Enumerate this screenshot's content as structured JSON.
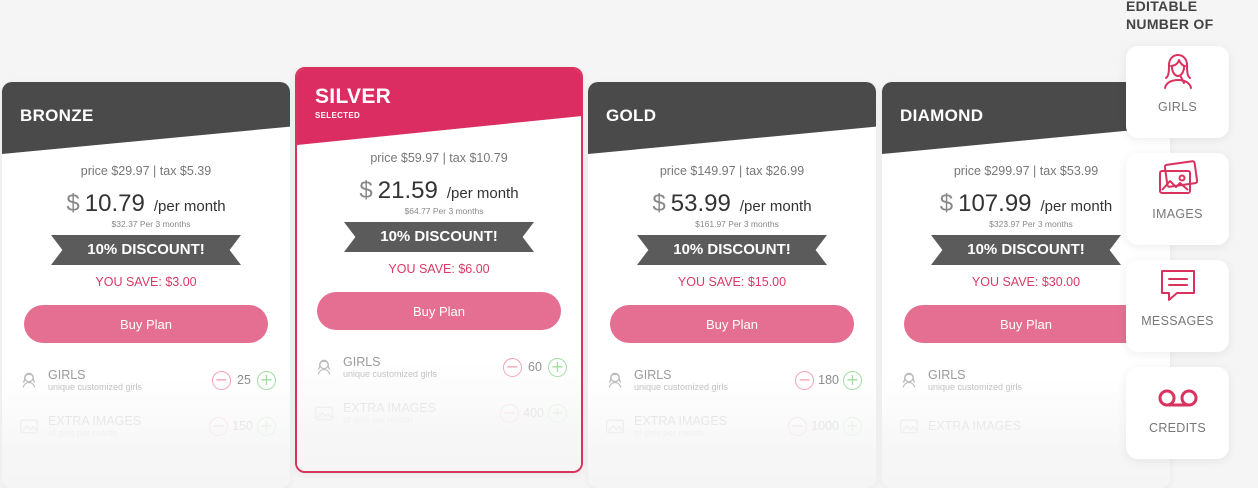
{
  "colors": {
    "accent": "#db2d62",
    "header_dark": "#4a4a4a",
    "button": "#e56f92",
    "save_text": "#d93a66",
    "discount_ribbon": "#5b5b5b"
  },
  "plans": [
    {
      "name": "BRONZE",
      "price_tax": "price $29.97 | tax $5.39",
      "currency": "$",
      "monthly": "10.79",
      "per_month": "/per month",
      "total": "$32.37 Per 3 months",
      "discount": "10% DISCOUNT!",
      "you_save": "YOU SAVE: $3.00",
      "buy_label": "Buy Plan",
      "features": [
        {
          "title": "GIRLS",
          "sub": "unique customized girls",
          "value": "25"
        },
        {
          "title": "EXTRA IMAGES",
          "sub": "of girls per month",
          "value": "150"
        }
      ]
    },
    {
      "name": "SILVER",
      "selected_label": "SELECTED",
      "price_tax": "price $59.97 | tax $10.79",
      "currency": "$",
      "monthly": "21.59",
      "per_month": "/per month",
      "total": "$64.77 Per 3 months",
      "discount": "10% DISCOUNT!",
      "you_save": "YOU SAVE: $6.00",
      "buy_label": "Buy Plan",
      "features": [
        {
          "title": "GIRLS",
          "sub": "unique customized girls",
          "value": "60"
        },
        {
          "title": "EXTRA IMAGES",
          "sub": "of girls per month",
          "value": "400"
        }
      ]
    },
    {
      "name": "GOLD",
      "price_tax": "price $149.97 | tax $26.99",
      "currency": "$",
      "monthly": "53.99",
      "per_month": "/per month",
      "total": "$161.97 Per 3 months",
      "discount": "10% DISCOUNT!",
      "you_save": "YOU SAVE: $15.00",
      "buy_label": "Buy Plan",
      "features": [
        {
          "title": "GIRLS",
          "sub": "unique customized girls",
          "value": "180"
        },
        {
          "title": "EXTRA IMAGES",
          "sub": "of girls per month",
          "value": "1000"
        }
      ]
    },
    {
      "name": "DIAMOND",
      "price_tax": "price $299.97 | tax $53.99",
      "currency": "$",
      "monthly": "107.99",
      "per_month": "/per month",
      "total": "$323.97 Per 3 months",
      "discount": "10% DISCOUNT!",
      "you_save": "YOU SAVE: $30.00",
      "buy_label": "Buy Plan",
      "features": [
        {
          "title": "GIRLS",
          "sub": "unique customized girls",
          "value": ""
        },
        {
          "title": "EXTRA IMAGES",
          "sub": "",
          "value": ""
        }
      ]
    }
  ],
  "stepper": {
    "minus": "−",
    "plus": "+"
  },
  "editable": {
    "title_line1": "EDITABLE",
    "title_line2": "NUMBER OF",
    "items": [
      {
        "label": "GIRLS",
        "icon": "girl-icon"
      },
      {
        "label": "IMAGES",
        "icon": "images-icon"
      },
      {
        "label": "MESSAGES",
        "icon": "message-icon"
      },
      {
        "label": "CREDITS",
        "icon": "voicemail-icon"
      }
    ]
  }
}
